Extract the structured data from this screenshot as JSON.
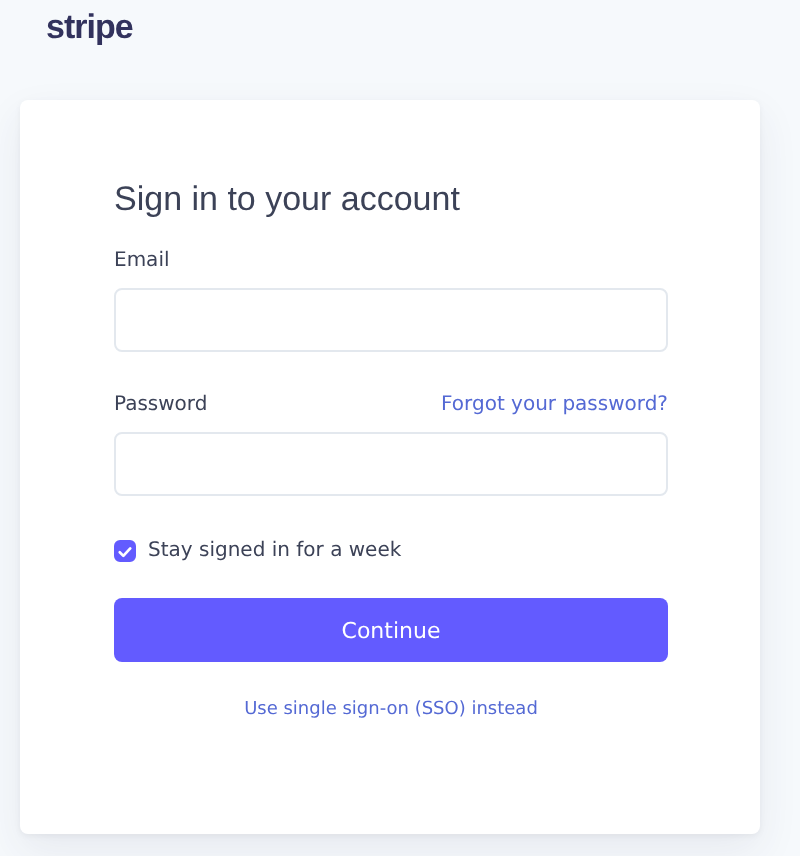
{
  "logo": "stripe",
  "form": {
    "title": "Sign in to your account",
    "fields": [
      {
        "label": "Email"
      },
      {
        "label": "Password",
        "link": "Forgot your password?"
      }
    ],
    "remember": {
      "label": "Stay signed in for a week",
      "checked": true
    },
    "submit": "Continue",
    "alternate": "Use single sign-on (SSO) instead"
  }
}
